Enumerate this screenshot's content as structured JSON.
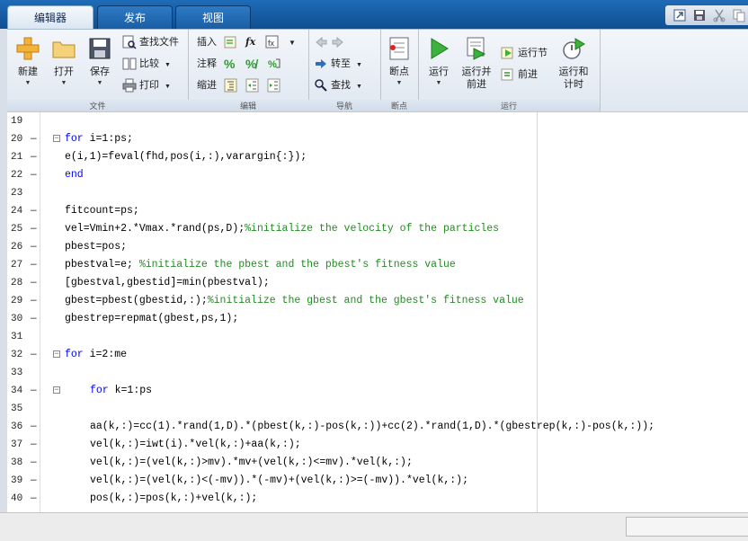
{
  "tabs": {
    "editor": "编辑器",
    "publish": "发布",
    "view": "视图"
  },
  "ribbon": {
    "file": {
      "label": "文件",
      "new": "新建",
      "open": "打开",
      "save": "保存",
      "find_files": "查找文件",
      "compare": "比较",
      "print": "打印"
    },
    "edit": {
      "label": "编辑",
      "insert": "插入",
      "comment": "注释",
      "indent": "缩进",
      "fx": "fx"
    },
    "navigate": {
      "label": "导航",
      "goto": "转至",
      "find": "查找"
    },
    "breakpoints": {
      "label": "断点",
      "breakpoints": "断点"
    },
    "run": {
      "label": "运行",
      "run": "运行",
      "run_advance_l1": "运行并",
      "run_advance_l2": "前进",
      "run_section": "运行节",
      "advance": "前进",
      "run_time_l1": "运行和",
      "run_time_l2": "计时"
    }
  },
  "colors": {
    "keyword": "#0000ff",
    "comment": "#228b22",
    "tab_bar": "#1a5ea4"
  },
  "code_lines": [
    {
      "n": "19",
      "bp": "",
      "fold": false,
      "indent": 0,
      "parts": []
    },
    {
      "n": "20",
      "bp": "—",
      "fold": true,
      "indent": 0,
      "parts": [
        [
          "kw",
          "for"
        ],
        [
          "",
          "&nbsp;i=1:ps;"
        ]
      ]
    },
    {
      "n": "21",
      "bp": "—",
      "fold": false,
      "indent": 0,
      "parts": [
        [
          "",
          "e(i,1)=feval(fhd,pos(i,:),varargin{:});"
        ]
      ]
    },
    {
      "n": "22",
      "bp": "—",
      "fold": false,
      "indent": 0,
      "parts": [
        [
          "kw",
          "end"
        ]
      ]
    },
    {
      "n": "23",
      "bp": "",
      "fold": false,
      "indent": 0,
      "parts": []
    },
    {
      "n": "24",
      "bp": "—",
      "fold": false,
      "indent": 0,
      "parts": [
        [
          "",
          "fitcount=ps;"
        ]
      ]
    },
    {
      "n": "25",
      "bp": "—",
      "fold": false,
      "indent": 0,
      "parts": [
        [
          "",
          "vel=Vmin+2.*Vmax.*rand(ps,D);"
        ],
        [
          "cm",
          "%initialize the velocity of the particles"
        ]
      ]
    },
    {
      "n": "26",
      "bp": "—",
      "fold": false,
      "indent": 0,
      "parts": [
        [
          "",
          "pbest=pos;"
        ]
      ]
    },
    {
      "n": "27",
      "bp": "—",
      "fold": false,
      "indent": 0,
      "parts": [
        [
          "",
          "pbestval=e; "
        ],
        [
          "cm",
          "%initialize the pbest and the pbest's fitness value"
        ]
      ]
    },
    {
      "n": "28",
      "bp": "—",
      "fold": false,
      "indent": 0,
      "parts": [
        [
          "",
          "[gbestval,gbestid]=min(pbestval);"
        ]
      ]
    },
    {
      "n": "29",
      "bp": "—",
      "fold": false,
      "indent": 0,
      "parts": [
        [
          "",
          "gbest=pbest(gbestid,:);"
        ],
        [
          "cm",
          "%initialize the gbest and the gbest's fitness value"
        ]
      ]
    },
    {
      "n": "30",
      "bp": "—",
      "fold": false,
      "indent": 0,
      "parts": [
        [
          "",
          "gbestrep=repmat(gbest,ps,1);"
        ]
      ]
    },
    {
      "n": "31",
      "bp": "",
      "fold": false,
      "indent": 0,
      "parts": []
    },
    {
      "n": "32",
      "bp": "—",
      "fold": true,
      "indent": 0,
      "parts": [
        [
          "kw",
          "for"
        ],
        [
          "",
          "&nbsp;i=2:me"
        ]
      ]
    },
    {
      "n": "33",
      "bp": "",
      "fold": false,
      "indent": 0,
      "parts": []
    },
    {
      "n": "34",
      "bp": "—",
      "fold": true,
      "indent": 1,
      "parts": [
        [
          "kw",
          "for"
        ],
        [
          "",
          "&nbsp;k=1:ps"
        ]
      ]
    },
    {
      "n": "35",
      "bp": "",
      "fold": false,
      "indent": 0,
      "parts": []
    },
    {
      "n": "36",
      "bp": "—",
      "fold": false,
      "indent": 1,
      "parts": [
        [
          "",
          "aa(k,:)=cc(1).*rand(1,D).*(pbest(k,:)-pos(k,:))+cc(2).*rand(1,D).*(gbestrep(k,:)-pos(k,:));"
        ]
      ]
    },
    {
      "n": "37",
      "bp": "—",
      "fold": false,
      "indent": 1,
      "parts": [
        [
          "",
          "vel(k,:)=iwt(i).*vel(k,:)+aa(k,:);"
        ]
      ]
    },
    {
      "n": "38",
      "bp": "—",
      "fold": false,
      "indent": 1,
      "parts": [
        [
          "",
          "vel(k,:)=(vel(k,:)>mv).*mv+(vel(k,:)<=mv).*vel(k,:);"
        ]
      ]
    },
    {
      "n": "39",
      "bp": "—",
      "fold": false,
      "indent": 1,
      "parts": [
        [
          "",
          "vel(k,:)=(vel(k,:)<(-mv)).*(-mv)+(vel(k,:)>=(-mv)).*vel(k,:);"
        ]
      ]
    },
    {
      "n": "40",
      "bp": "—",
      "fold": false,
      "indent": 1,
      "parts": [
        [
          "",
          "pos(k,:)=pos(k,:)+vel(k,:);"
        ]
      ]
    }
  ]
}
